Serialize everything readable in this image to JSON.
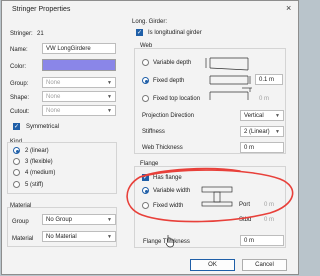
{
  "window": {
    "title": "Stringer Properties",
    "close": "×"
  },
  "left": {
    "stringer_label": "Stringer:",
    "stringer_value": "21",
    "name_label": "Name:",
    "name_value": "VW LongGirdere",
    "color_label": "Color:",
    "color_value": "#8a86e8",
    "group_label": "Group:",
    "group_value": "None",
    "shape_label": "Shape:",
    "shape_value": "None",
    "cutout_label": "Cutout:",
    "cutout_value": "None",
    "symmetrical_label": "Symmetrical",
    "kind_title": "Kind",
    "kind_options": [
      "2 (linear)",
      "3 (flexible)",
      "4 (medium)",
      "5 (stiff)"
    ],
    "material_title": "Material",
    "group2_label": "Group",
    "group2_value": "No Group",
    "material_label": "Material",
    "material_value": "No Material"
  },
  "right": {
    "long_girder_title": "Long. Girder:",
    "is_longitudinal_label": "Is longitudinal girder",
    "web_title": "Web",
    "variable_depth_label": "Variable depth",
    "fixed_depth_label": "Fixed depth",
    "fixed_depth_value": "0.1 m",
    "fixed_top_label": "Fixed top location",
    "fixed_top_value": "0 m",
    "projection_label": "Projection Direction",
    "projection_value": "Vertical",
    "stiffness_label": "Stiffness",
    "stiffness_value": "2 (Linear)",
    "web_thickness_label": "Web Thickness",
    "web_thickness_value": "0 m",
    "flange_title": "Flange",
    "has_flange_label": "Has flange",
    "variable_width_label": "Variable width",
    "fixed_width_label": "Fixed width",
    "port_label": "Port",
    "port_value": "0 m",
    "stbd_label": "Stbd",
    "stbd_value": "0 m",
    "flange_thickness_label": "Flange Thickness",
    "flange_thickness_value": "0 m"
  },
  "buttons": {
    "ok": "OK",
    "cancel": "Cancel"
  },
  "annotation": {
    "color": "#e8403a"
  }
}
